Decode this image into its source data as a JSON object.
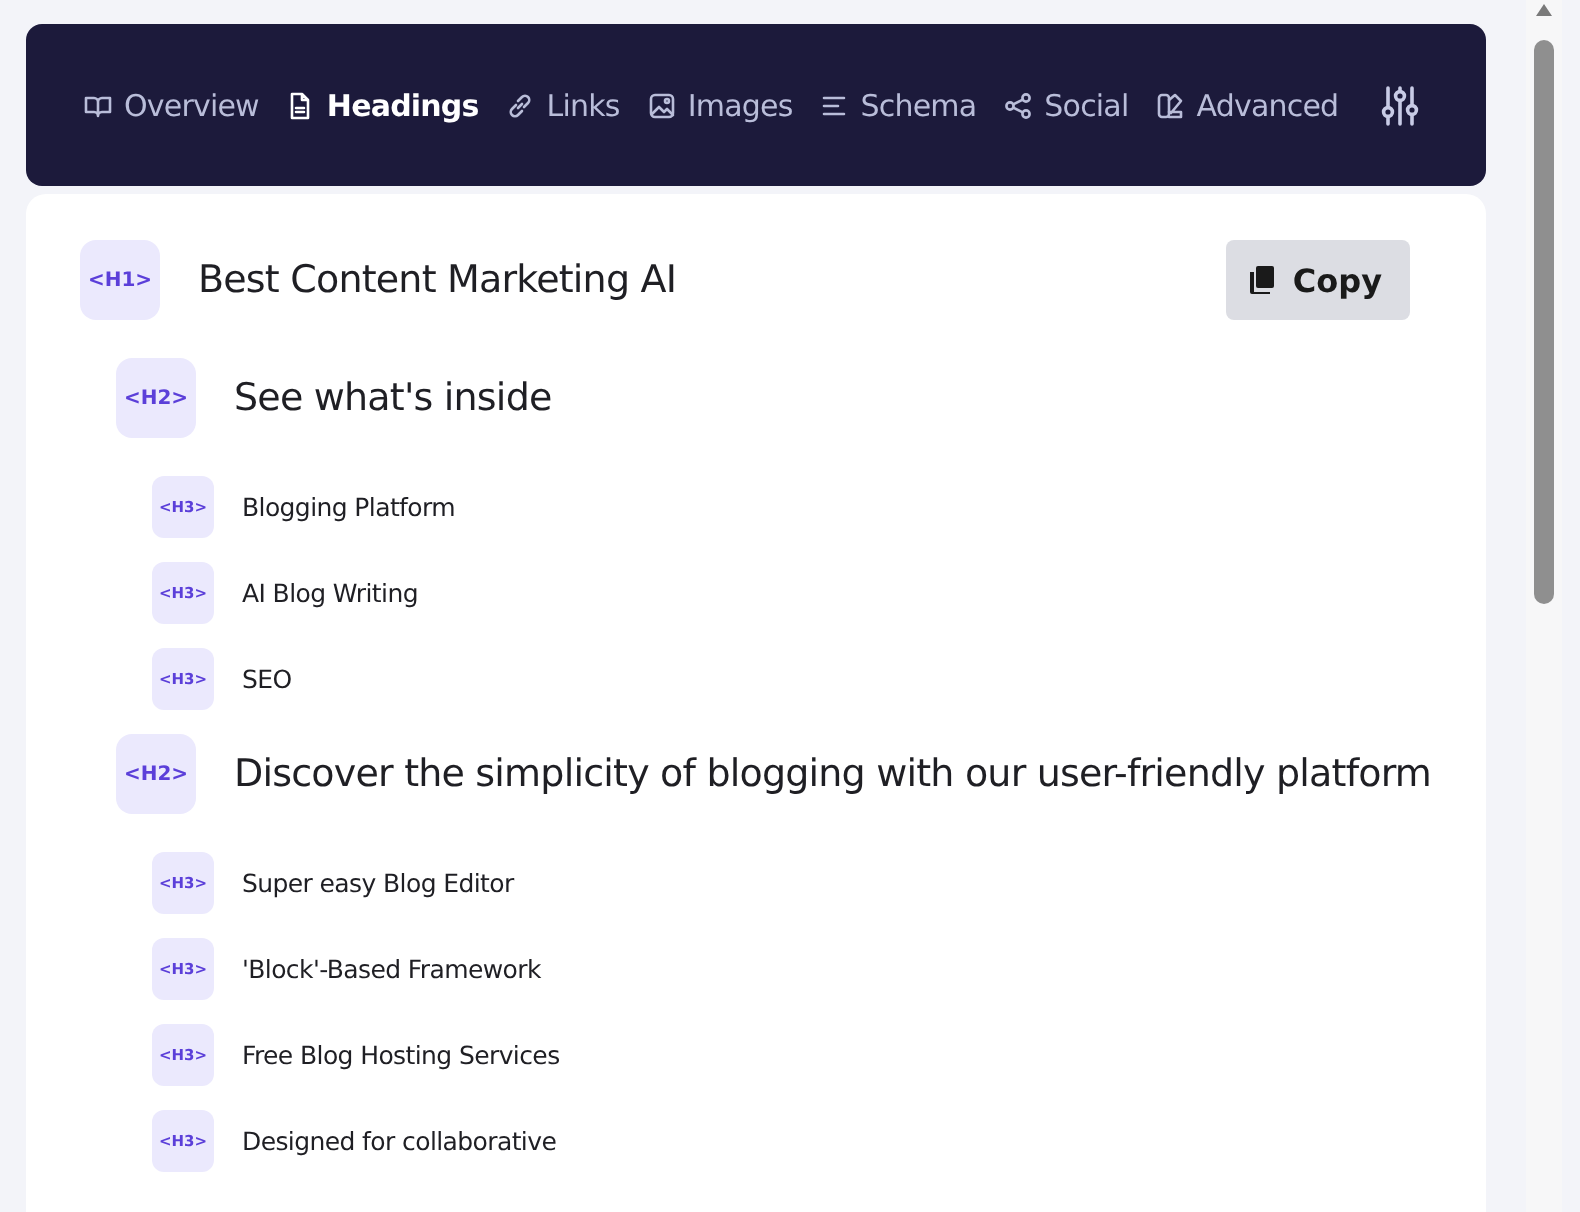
{
  "tabs": [
    {
      "label": "Overview",
      "kind": "book",
      "selected": false
    },
    {
      "label": "Headings",
      "kind": "file",
      "selected": true
    },
    {
      "label": "Links",
      "kind": "link",
      "selected": false
    },
    {
      "label": "Images",
      "kind": "image",
      "selected": false
    },
    {
      "label": "Schema",
      "kind": "lines",
      "selected": false
    },
    {
      "label": "Social",
      "kind": "share",
      "selected": false
    },
    {
      "label": "Advanced",
      "kind": "palette",
      "selected": false
    }
  ],
  "copy_button": "Copy",
  "headings": [
    {
      "kind": "h1",
      "tag": "<H1>",
      "text": "Best Content Marketing AI",
      "children": [
        {
          "kind": "h2",
          "tag": "<H2>",
          "text": "See what's inside",
          "children": [
            {
              "kind": "h3",
              "tag": "<H3>",
              "text": "Blogging Platform"
            },
            {
              "kind": "h3",
              "tag": "<H3>",
              "text": "AI Blog Writing"
            },
            {
              "kind": "h3",
              "tag": "<H3>",
              "text": "SEO"
            }
          ]
        },
        {
          "kind": "h2",
          "tag": "<H2>",
          "text": "Discover the simplicity of blogging with our user-friendly platform",
          "children": [
            {
              "kind": "h3",
              "tag": "<H3>",
              "text": "Super easy Blog Editor"
            },
            {
              "kind": "h3",
              "tag": "<H3>",
              "text": "'Block'-Based Framework"
            },
            {
              "kind": "h3",
              "tag": "<H3>",
              "text": "Free Blog Hosting Services"
            },
            {
              "kind": "h3",
              "tag": "<H3>",
              "text": "Designed for collaborative"
            }
          ]
        }
      ]
    }
  ]
}
